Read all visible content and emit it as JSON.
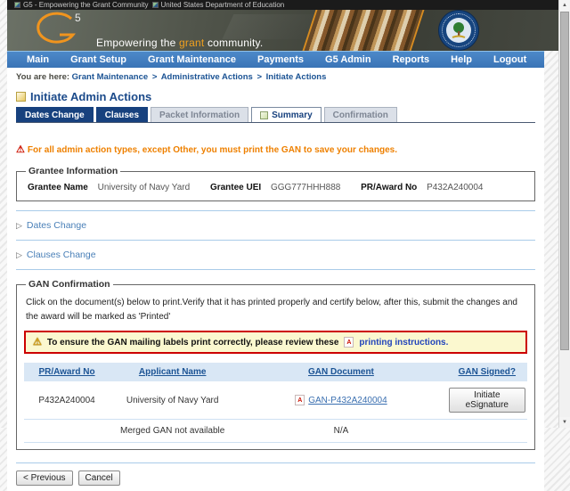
{
  "window": {
    "tabs": [
      {
        "label": "G5 - Empowering the Grant Community"
      },
      {
        "label": "United States Department of Education"
      }
    ]
  },
  "header": {
    "logo_sup": "5",
    "tagline_pre": "Empowering the ",
    "tagline_accent": "grant",
    "tagline_post": " community."
  },
  "nav": {
    "items": [
      "Main",
      "Grant Setup",
      "Grant Maintenance",
      "Payments",
      "G5 Admin",
      "Reports",
      "Help",
      "Logout"
    ]
  },
  "breadcrumb": {
    "label": "You are here:",
    "separator": ">",
    "items": [
      "Grant Maintenance",
      "Administrative Actions",
      "Initiate Actions"
    ]
  },
  "page": {
    "title": "Initiate Admin Actions"
  },
  "tabs": [
    {
      "label": "Dates Change",
      "state": "active"
    },
    {
      "label": "Clauses",
      "state": "active"
    },
    {
      "label": "Packet Information",
      "state": "disabled"
    },
    {
      "label": "Summary",
      "state": "current"
    },
    {
      "label": "Confirmation",
      "state": "disabled"
    }
  ],
  "warning": {
    "text": "For all admin action types, except Other, you must print the GAN to save your changes."
  },
  "grantee": {
    "legend": "Grantee Information",
    "name_label": "Grantee Name",
    "name": "University of Navy Yard",
    "uei_label": "Grantee UEI",
    "uei": "GGG777HHH888",
    "award_label": "PR/Award No",
    "award": "P432A240004"
  },
  "sections": [
    {
      "label": "Dates Change"
    },
    {
      "label": "Clauses Change"
    }
  ],
  "gan": {
    "legend": "GAN Confirmation",
    "description": "Click on the document(s) below to print.Verify that it has printed properly and certify below, after this, submit the changes and the award will be marked as 'Printed'",
    "notice": {
      "text": "To ensure the GAN mailing labels print correctly, please review these",
      "link": "printing instructions."
    },
    "table": {
      "headers": [
        "PR/Award No",
        "Applicant Name",
        "GAN Document",
        "GAN Signed?"
      ],
      "rows": [
        {
          "award": "P432A240004",
          "applicant": "University of Navy Yard",
          "document": "GAN-P432A240004",
          "signed_button": "Initiate eSignature"
        },
        {
          "award": "",
          "applicant": "Merged GAN not available",
          "document": "N/A",
          "signed": ""
        }
      ]
    }
  },
  "footer": {
    "previous_label": "< Previous",
    "cancel_label": "Cancel"
  },
  "icons": {
    "alert_icon": "⚠",
    "warning_icon": "⚠",
    "expand_icon": "▷",
    "pdf_icon": "A",
    "scroll_up_icon": "▲",
    "scroll_down_icon": "▼"
  },
  "colors": {
    "accent_orange": "#f0941e",
    "nav_blue": "#3f7cc0",
    "tab_navy": "#17417e",
    "link_blue": "#1b5394",
    "warning_orange": "#ee8000",
    "notice_border_red": "#cc0000",
    "notice_bg_yellow": "#fbf8cf",
    "table_header_bg": "#d9e7f5",
    "rule_light_blue": "#a9cbe9"
  }
}
